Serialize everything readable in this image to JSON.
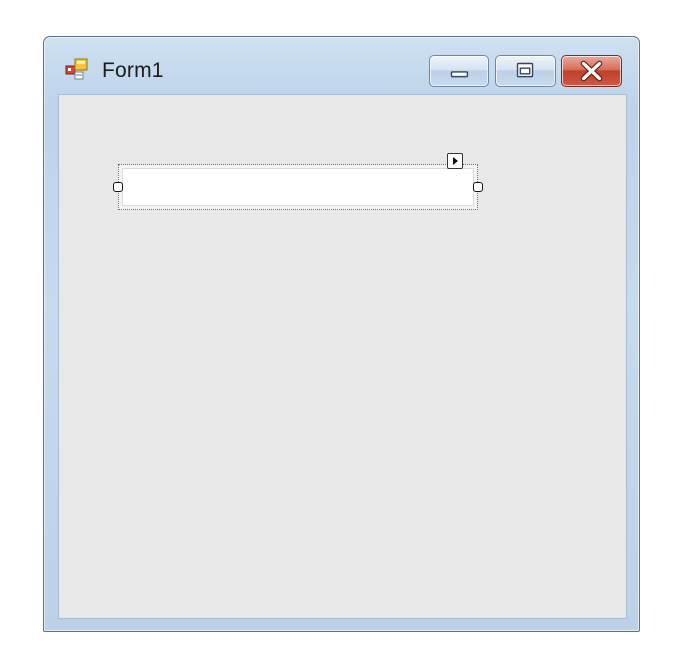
{
  "window": {
    "title": "Form1",
    "app_icon": "winforms-app-icon",
    "buttons": {
      "minimize_icon": "minimize-icon",
      "maximize_icon": "maximize-icon",
      "close_icon": "close-icon"
    }
  },
  "designer": {
    "textbox": {
      "value": "",
      "selected": true
    },
    "smart_tag_icon": "smart-tag-arrow-icon"
  },
  "colors": {
    "frame": "#bcd3ea",
    "client_background": "#e8e8e8",
    "close_button": "#c1402a"
  }
}
